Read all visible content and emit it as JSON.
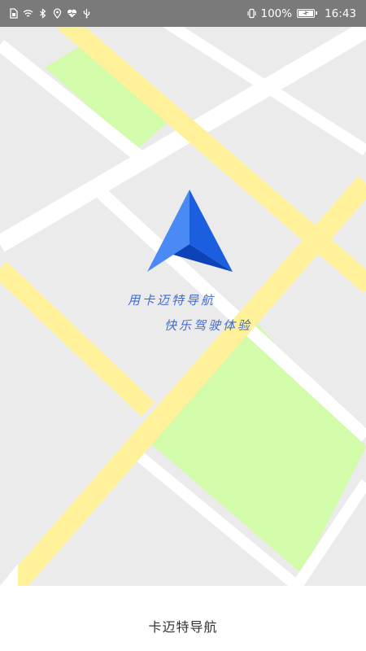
{
  "status_bar": {
    "left_icons": [
      "sim-card-icon",
      "wifi-icon",
      "bluetooth-icon",
      "location-icon",
      "heart-icon",
      "usb-icon"
    ],
    "vibrate_icon": "vibrate-icon",
    "battery_percent": "100%",
    "battery_level": 1.0,
    "time": "16:43"
  },
  "map": {
    "colors": {
      "background": "#ebebeb",
      "minor_road": "#ffffff",
      "major_road": "#fff09a",
      "park": "#d2fbaa"
    }
  },
  "logo": {
    "icon": "navigation-arrow-icon",
    "colors": {
      "left_face": "#4a8af4",
      "right_face": "#1b5fe0",
      "bottom_face": "#0d42b8"
    }
  },
  "slogan": {
    "line1": "用卡迈特导航",
    "line2": "快乐驾驶体验",
    "color": "#3f6ad8"
  },
  "bottom_bar": {
    "app_name": "卡迈特导航"
  }
}
